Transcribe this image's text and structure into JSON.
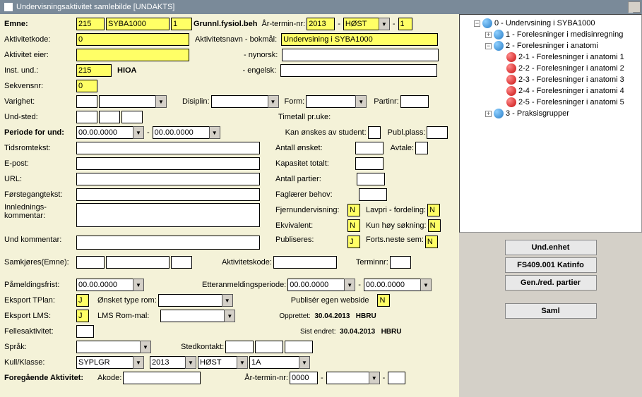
{
  "window": {
    "title": "Undervisningsaktivitet samlebilde   [UNDAKTS]"
  },
  "form": {
    "emne": {
      "label": "Emne:",
      "code": "215",
      "subject": "SYBA1000",
      "ver": "1",
      "desc": "Grunnl.fysiol.beh",
      "ar_termin_label": "År-termin-nr:",
      "year": "2013",
      "term": "HØST",
      "nr": "1"
    },
    "aktivitetkode": {
      "label": "Aktivitetkode:",
      "value": "0",
      "navn_label": "Aktivitetsnavn  - bokmål:",
      "navn_value": "Undervsining i SYBA1000"
    },
    "aktivitet_eier": {
      "label": "Aktivitet eier:",
      "value": "",
      "nynorsk_label": "- nynorsk:"
    },
    "inst_und": {
      "label": "Inst. und.:",
      "val1": "215",
      "val2": "HIOA",
      "engelsk_label": "- engelsk:"
    },
    "sekvensnr": {
      "label": "Sekvensnr:",
      "value": "0"
    },
    "varighet": {
      "label": "Varighet:"
    },
    "disiplin": {
      "label": "Disiplin:"
    },
    "form_label": "Form:",
    "partinr_label": "Partinr:",
    "und_sted": {
      "label": "Und-sted:"
    },
    "timetall": {
      "label": "Timetall pr.uke:"
    },
    "periode_for_und": {
      "label": "Periode for und:",
      "d1": "00.00.0000",
      "d2": "00.00.0000"
    },
    "kan_onskes": {
      "label": "Kan ønskes av student:"
    },
    "publ_plass": {
      "label": "Publ.plass:"
    },
    "tidsromtekst": {
      "label": "Tidsromtekst:"
    },
    "antall_onsket": {
      "label": "Antall ønsket:"
    },
    "avtale": {
      "label": "Avtale:"
    },
    "epost": {
      "label": "E-post:"
    },
    "kapasitet": {
      "label": "Kapasitet totalt:"
    },
    "url": {
      "label": "URL:"
    },
    "antall_partier": {
      "label": "Antall partier:"
    },
    "forstegang": {
      "label": "Førstegangtekst:"
    },
    "faglarer": {
      "label": "Faglærer behov:"
    },
    "innlednings": {
      "label": "Innlednings-",
      "label2": "kommentar:"
    },
    "fjernund": {
      "label": "Fjernundervisning:",
      "v": "N"
    },
    "lavpri": {
      "label": "Lavpri - fordeling:",
      "v": "N"
    },
    "ekvivalent": {
      "label": "Ekvivalent:",
      "v": "N"
    },
    "kunhoy": {
      "label": "Kun høy søkning:",
      "v": "N"
    },
    "publiseres": {
      "label": "Publiseres:",
      "v": "J"
    },
    "forts": {
      "label": "Forts.neste sem:",
      "v": "N"
    },
    "und_kommentar": {
      "label": "Und kommentar:"
    },
    "samkjores": {
      "label": "Samkjøres(Emne):",
      "akt_label": "Aktivitetskode:",
      "term_label": "Terminnr:"
    },
    "pamelding": {
      "label": "Påmeldingsfrist:",
      "d": "00.00.0000",
      "etter_label": "Etteranmeldingsperiode:",
      "d1": "00.00.0000",
      "d2": "00.00.0000"
    },
    "eksport_tplan": {
      "label": "Eksport TPlan:",
      "v": "J",
      "rom_label": "Ønsket type rom:",
      "pub_label": "Publisér egen webside",
      "pub_v": "N"
    },
    "eksport_lms": {
      "label": "Eksport LMS:",
      "v": "J",
      "mal_label": "LMS Rom-mal:"
    },
    "opprettet": {
      "label": "Opprettet:",
      "date": "30.04.2013",
      "user": "HBRU"
    },
    "sistendret": {
      "label": "Sist endret:",
      "date": "30.04.2013",
      "user": "HBRU"
    },
    "fellesaktivitet": {
      "label": "Fellesaktivitet:"
    },
    "sprak": {
      "label": "Språk:",
      "stedk_label": "Stedkontakt:"
    },
    "kull": {
      "label": "Kull/Klasse:",
      "v1": "SYPLGR",
      "v2": "2013",
      "v3": "HØST",
      "v4": "1A"
    },
    "foregaende": {
      "label": "Foregående Aktivitet:",
      "akode": "Akode:",
      "ar": "År-termin-nr:",
      "year": "0000"
    }
  },
  "tree": {
    "root": "0 - Undervsining i SYBA1000",
    "n1": "1 - Forelesninger i medisinregning",
    "n2": "2 - Forelesninger i anatomi",
    "n21": "2-1 - Forelesninger i anatomi 1",
    "n22": "2-2 - Forelesninger i anatomi 2",
    "n23": "2-3 - Forelesninger i anatomi 3",
    "n24": "2-4 - Forelesninger i anatomi 4",
    "n25": "2-5 - Forelesninger i anatomi 5",
    "n3": "3 - Praksisgrupper"
  },
  "buttons": {
    "und_enhet": "Und.enhet",
    "katinfo": "FS409.001 Katinfo",
    "gen": "Gen./red. partier",
    "saml": "Saml"
  }
}
